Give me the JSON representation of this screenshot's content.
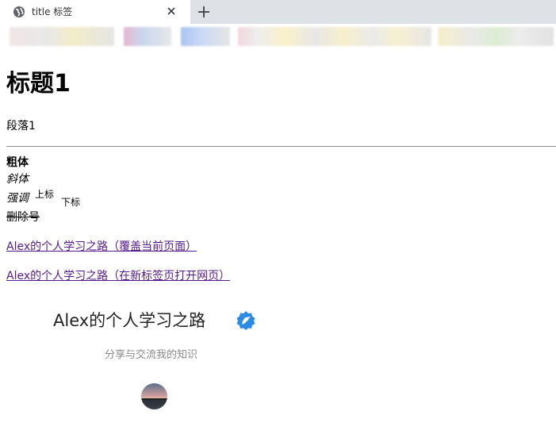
{
  "browser": {
    "tab_title": "title 标签",
    "tab_icon": "globe-icon",
    "close_icon": "close-icon",
    "new_tab_icon": "plus-icon"
  },
  "page": {
    "heading": "标题1",
    "paragraph": "段落1",
    "bold": "粗体",
    "italic": "斜体",
    "emphasis": "强调",
    "superscript": "上标",
    "subscript": "下标",
    "strikethrough": "删除号",
    "link_same_page": "Alex的个人学习之路（覆盖当前页面）",
    "link_new_tab": "Alex的个人学习之路（在新标签页打开网页）"
  },
  "profile": {
    "name": "Alex的个人学习之路",
    "description": "分享与交流我的知识",
    "verified_icon": "verified-badge-icon",
    "verified_color": "#2b8ae6",
    "avatar": "avatar-image"
  },
  "colors": {
    "link_visited": "#551a8b",
    "tabstrip_bg": "#dee1e6"
  }
}
